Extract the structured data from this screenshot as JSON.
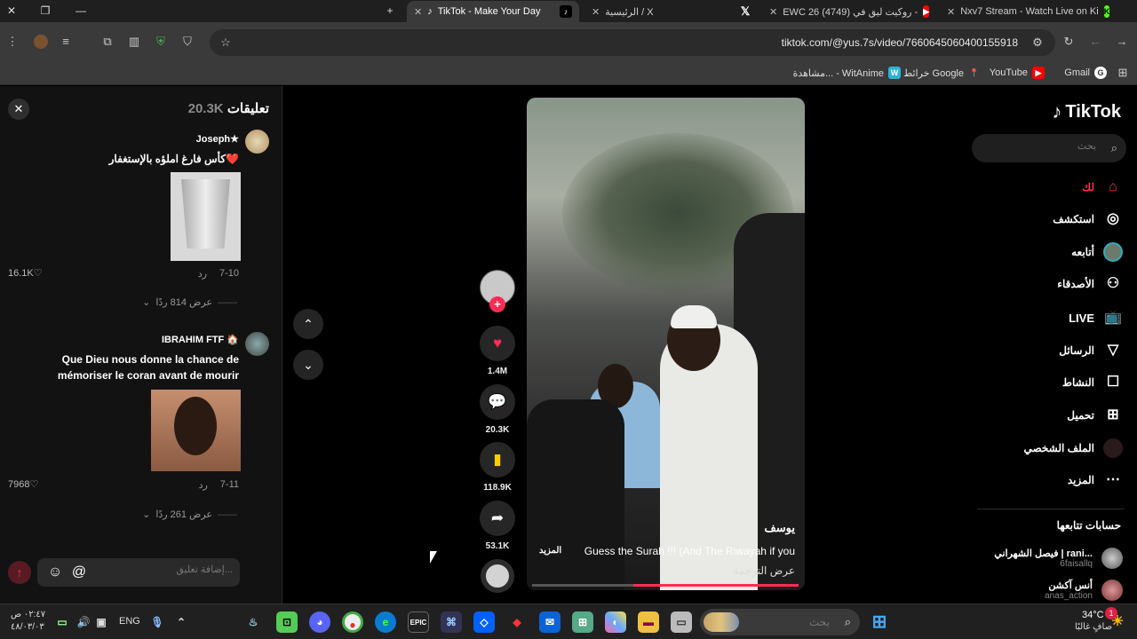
{
  "browser": {
    "tabs": [
      {
        "title": "Nxv7 Stream - Watch Live on Ki",
        "active": false
      },
      {
        "title": "EWC 26 روكيت ليق في (4749) -",
        "active": false
      },
      {
        "title": "الرئيسية / X",
        "active": false
      },
      {
        "title": "TikTok - Make Your Day",
        "active": true
      }
    ],
    "url": "tiktok.com/@yus.7s/video/7660645060400155918",
    "bookmarks": [
      "Gmail",
      "YouTube",
      "خرائط Google",
      "مشاهدة... - WitAnime"
    ]
  },
  "comments": {
    "title": "تعليقات",
    "count": "20.3K",
    "items": [
      {
        "user": "Joseph★",
        "text": "كأس فارغ املؤه بالإستغفار❤️",
        "date": "7-10",
        "reply": "رد",
        "likes": "16.1K",
        "view_replies": "عرض 814 ردًا"
      },
      {
        "user": "IBRAHIM FTF 🏠",
        "text": "Que Dieu nous donne la chance de mémoriser le coran avant de mourir",
        "date": "7-11",
        "reply": "رد",
        "likes": "7968",
        "view_replies": "عرض 261 ردًا"
      }
    ],
    "input_placeholder": "إضافة تعليق..."
  },
  "video": {
    "username": "يوسف",
    "caption": "Guess the Surah !!! (And The Riwayah if you",
    "more": "المزيد",
    "translate": "عرض الترجمة",
    "progress": 0.62
  },
  "actions": {
    "likes": "1.4M",
    "comments": "20.3K",
    "saves": "118.9K",
    "shares": "53.1K"
  },
  "sidebar": {
    "logo": "TikTok",
    "search_placeholder": "بحث",
    "nav": [
      {
        "label": "لك",
        "icon": "home-icon",
        "selected": true
      },
      {
        "label": "استكشف",
        "icon": "compass-icon",
        "selected": false
      },
      {
        "label": "أتابعه",
        "icon": "following-avatar-icon",
        "selected": false
      },
      {
        "label": "الأصدقاء",
        "icon": "friends-icon",
        "selected": false
      },
      {
        "label": "LIVE",
        "icon": "live-icon",
        "selected": false
      },
      {
        "label": "الرسائل",
        "icon": "messages-icon",
        "selected": false
      },
      {
        "label": "النشاط",
        "icon": "activity-icon",
        "selected": false
      },
      {
        "label": "تحميل",
        "icon": "upload-icon",
        "selected": false
      },
      {
        "label": "الملف الشخصي",
        "icon": "profile-icon",
        "selected": false
      },
      {
        "label": "المزيد",
        "icon": "more-icon",
        "selected": false
      }
    ],
    "following_title": "حسابات تتابعها",
    "following": [
      {
        "name": "فيصل الشهراني | rani...",
        "handle": "6faisallq"
      },
      {
        "name": "أنس آكشن",
        "handle": "anas_action"
      }
    ]
  },
  "taskbar": {
    "search_placeholder": "بحث",
    "weather_temp": "34°C",
    "weather_desc": "صافٍ غالبًا",
    "lang": "ENG",
    "time": "٠٢:٤٧ ص",
    "date": "٤٨/٠٣/٠٣",
    "notif_badge": "1"
  },
  "colors": {
    "accent": "#fe2c55",
    "bg": "#000000",
    "panel": "#121212"
  }
}
